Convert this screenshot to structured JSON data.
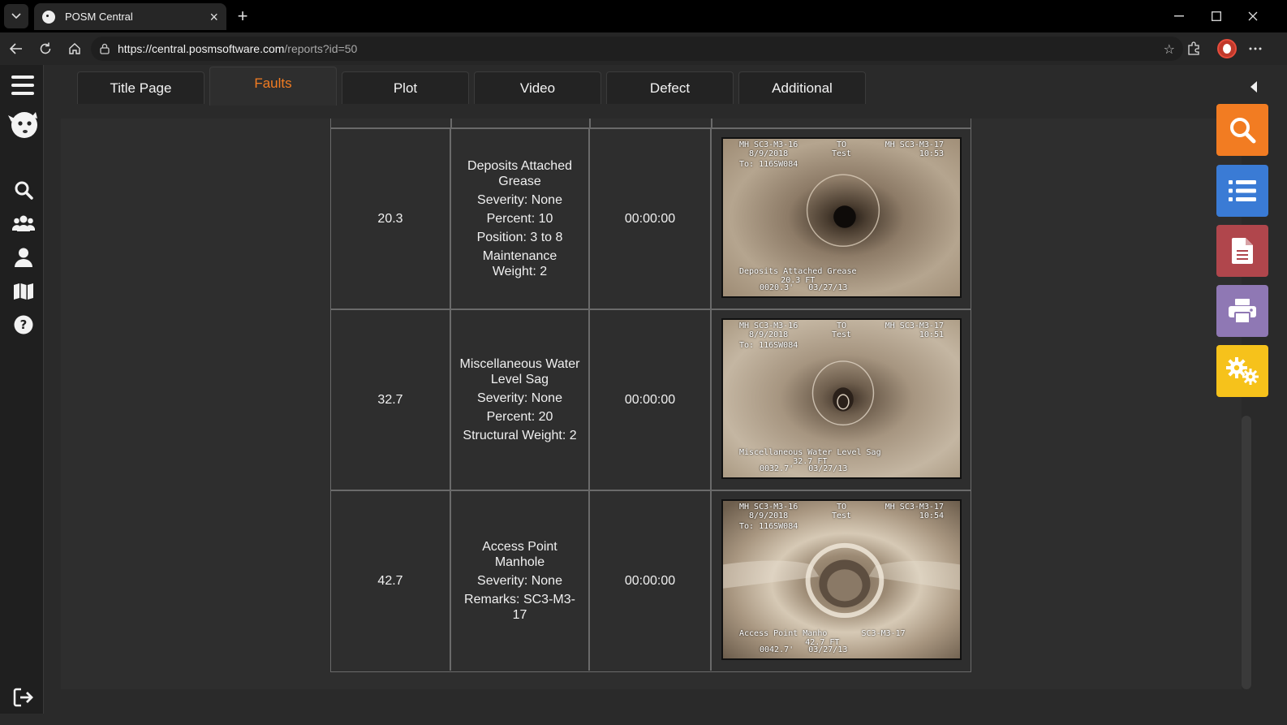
{
  "browser": {
    "tab_title": "POSM Central",
    "url_main": "https://central.posmsoftware.com",
    "url_rest": "/reports?id=50"
  },
  "tabs": [
    {
      "label": "Title Page",
      "active": false
    },
    {
      "label": "Faults",
      "active": true
    },
    {
      "label": "Plot",
      "active": false
    },
    {
      "label": "Video",
      "active": false
    },
    {
      "label": "Defect",
      "active": false
    },
    {
      "label": "Additional",
      "active": false
    }
  ],
  "colors": {
    "accent": "#f27c22",
    "search_tool": "#f27c22",
    "list_tool": "#3a7bd5",
    "report_tool": "#b0464c",
    "print_tool": "#8f78b4",
    "settings_tool": "#f6c21b"
  },
  "sidebar": {
    "icons": [
      "search-icon",
      "users-icon",
      "user-icon",
      "map-icon",
      "help-icon"
    ]
  },
  "faults": [
    {
      "distance": "20.3",
      "lines": [
        "Deposits Attached Grease",
        "Severity: None",
        "Percent: 10",
        "Position: 3 to 8",
        "Maintenance Weight: 2"
      ],
      "time": "00:00:00",
      "overlay": {
        "top_left": "MH SC3-M3-16\n8/9/2018",
        "to": "TO\nTest",
        "top_right": "MH SC3-M3-17\n10:53",
        "from": "To: 116SW084",
        "bottom": "Deposits Attached Grease\n20.3 FT",
        "footer": "0020.3'   03/27/13"
      }
    },
    {
      "distance": "32.7",
      "lines": [
        "Miscellaneous Water Level Sag",
        "Severity: None",
        "Percent: 20",
        "Structural Weight: 2"
      ],
      "time": "00:00:00",
      "overlay": {
        "top_left": "MH SC3-M3-16\n8/9/2018",
        "to": "TO\nTest",
        "top_right": "MH SC3-M3-17\n10:51",
        "from": "To: 116SW084",
        "bottom": "Miscellaneous Water Level Sag\n32.7 FT",
        "footer": "0032.7'   03/27/13"
      }
    },
    {
      "distance": "42.7",
      "lines": [
        "Access Point Manhole",
        "Severity: None",
        "Remarks: SC3-M3-17"
      ],
      "time": "00:00:00",
      "overlay": {
        "top_left": "MH SC3-M3-16\n8/9/2018",
        "to": "TO\nTest",
        "top_right": "MH SC3-M3-17\n10:54",
        "from": "To: 116SW084",
        "bottom": "Access Point Manho       SC3-M3-17\n42.7 FT",
        "footer": "0042.7'   03/27/13"
      }
    }
  ]
}
